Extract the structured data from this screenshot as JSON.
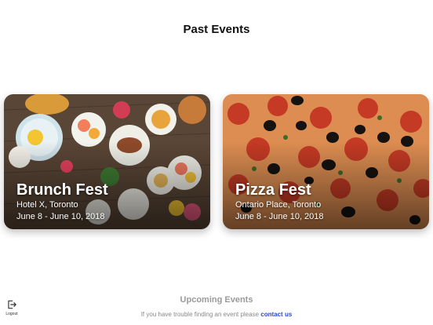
{
  "header": {
    "title": "Past Events"
  },
  "events": [
    {
      "title": "Brunch Fest",
      "venue": "Hotel X, Toronto",
      "dates": "June 8 - June 10, 2018"
    },
    {
      "title": "Pizza Fest",
      "venue": "Ontario Place, Toronto",
      "dates": "June 8 - June 10, 2018"
    }
  ],
  "upcoming": {
    "title": "Upcoming Events"
  },
  "help": {
    "text": "If you have trouble finding an event please",
    "link_label": "contact us"
  },
  "logout": {
    "label": "Logout",
    "icon": "logout-icon"
  },
  "colors": {
    "link": "#2a4bd4",
    "muted_heading": "#9a9a9a"
  }
}
